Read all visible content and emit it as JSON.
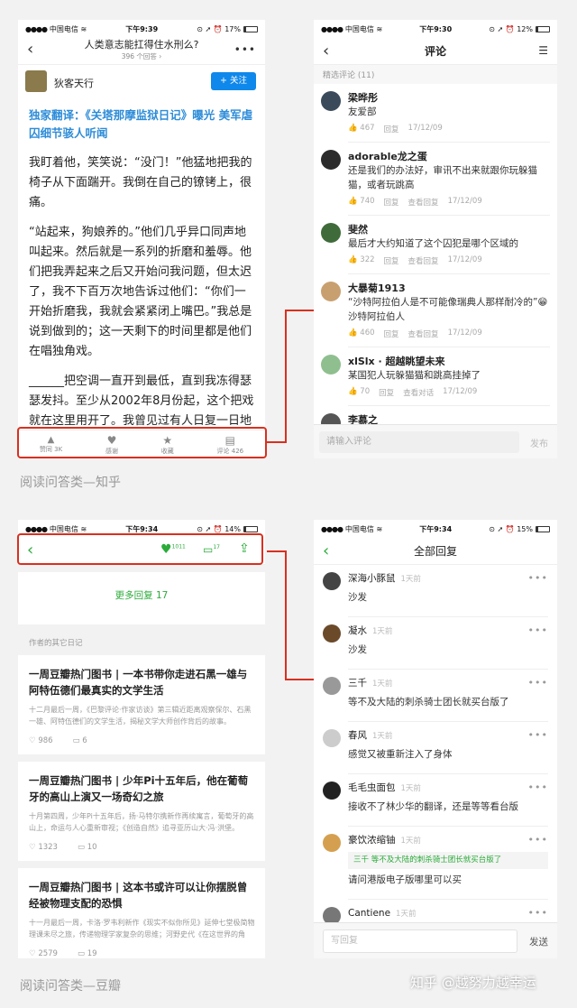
{
  "zhihu": {
    "status": {
      "carrier": "中国电信",
      "time": "下午9:39",
      "battery": "17%"
    },
    "nav_title": "人类意志能扛得住水刑么?",
    "nav_sub": "396 个回答",
    "author": "狄客天行",
    "follow": "+ 关注",
    "link": "独家翻译：《关塔那摩监狱日记》曝光 美军虐囚细节骇人听闻",
    "paragraphs": [
      "我盯着他，笑笑说：“没门！”他猛地把我的椅子从下面踹开。我倒在自己的镣铐上，很痛。",
      "“站起来，狗娘养的。”他们几乎异口同声地叫起来。然后就是一系列的折磨和羞辱。他们把我弄起来之后又开始问我问题，但太迟了，我不下百万次地告诉过他们：“你们一开始折磨我，我就会紧紧闭上嘴巴。”我总是说到做到的；这一天剩下的时间里都是他们在唱独角戏。",
      "______把空调一直开到最低，直到我冻得瑟瑟发抖。至少从2002年8月份起，这个把戏就在这里用开了。我曾见过有人日复一日地被关在冷冻室里；我可以给出一份长长的名"
    ],
    "bar": [
      "赞同 3K",
      "感谢",
      "收藏",
      "评论 426"
    ]
  },
  "zhihu_comments": {
    "status": {
      "carrier": "中国电信",
      "time": "下午9:30",
      "battery": "12%"
    },
    "title": "评论",
    "section": "精选评论 (11)",
    "items": [
      {
        "name": "梁晔彤",
        "text": "友爱部",
        "likes": "467",
        "reply": "回复",
        "view": "",
        "date": "17/12/09"
      },
      {
        "name": "adorable龙之蛋",
        "text": "还是我们的办法好，审讯不出来就跟你玩躲猫猫，或者玩跳高",
        "likes": "740",
        "reply": "回复",
        "view": "查看回复",
        "date": "17/12/09"
      },
      {
        "name": "斐然",
        "text": "最后才大约知道了这个囚犯是哪个区域的",
        "likes": "322",
        "reply": "回复",
        "view": "查看回复",
        "date": "17/12/09"
      },
      {
        "name": "大暴菊1913",
        "text": "“沙特阿拉伯人是不可能像瑞典人那样耐冷的”😁沙特阿拉伯人",
        "likes": "460",
        "reply": "回复",
        "view": "查看回复",
        "date": "17/12/09"
      },
      {
        "name": "xlSlx · 超越眺望未来",
        "text": "某国犯人玩躲猫猫和跳高挂掉了",
        "likes": "70",
        "reply": "回复",
        "view": "查看对话",
        "date": "17/12/09"
      },
      {
        "name": "李慕之",
        "text": "",
        "likes": "",
        "reply": "",
        "view": "",
        "date": ""
      }
    ],
    "input_placeholder": "请输入评论",
    "send": "发布"
  },
  "caption1": "阅读问答类—知乎",
  "douban": {
    "status": {
      "carrier": "中国电信",
      "time": "下午9:34",
      "battery": "14%"
    },
    "likes": "1011",
    "comments": "17",
    "more_replies": "更多回复 17",
    "section": "作者的其它日记",
    "items": [
      {
        "title": "一周豆瓣热门图书 | 一本书带你走进石黑一雄与阿特伍德们最真实的文学生活",
        "summary": "十二月最后一周，《巴黎评论·作家访谈》第三辑近距离观察保尔、石黑一雄、阿特伍德们的文学生活，揭秘文学大师创作背后的故事。",
        "likes": "986",
        "comments": "6"
      },
      {
        "title": "一周豆瓣热门图书 | 少年Pi十五年后，他在葡萄牙的高山上演又一场奇幻之旅",
        "summary": "十月第四周，少年Pi十五年后，扬·马特尔携新作再续寓言，葡萄牙的高山上，命运与人心重新审视；《创造自然》追寻亚历山大·冯·洪堡。",
        "likes": "1323",
        "comments": "10"
      },
      {
        "title": "一周豆瓣热门图书 | 这本书或许可以让你摆脱曾经被物理支配的恐惧",
        "summary": "十一月最后一周，卡洛·罗韦利新作《现实不似你所见》延伸七堂极简物理课未尽之旅，传递物理学家复杂的思维；河野史代《在这世界的角落》。",
        "likes": "2579",
        "comments": "19"
      }
    ]
  },
  "douban_replies": {
    "status": {
      "carrier": "中国电信",
      "time": "下午9:34",
      "battery": "15%"
    },
    "title": "全部回复",
    "items": [
      {
        "name": "深海小豚鼠",
        "time": "1天前",
        "text": "沙发",
        "quote": ""
      },
      {
        "name": "凝水",
        "time": "1天前",
        "text": "沙发",
        "quote": ""
      },
      {
        "name": "三千",
        "time": "1天前",
        "text": "等不及大陆的刺杀骑士团长就买台版了",
        "quote": ""
      },
      {
        "name": "春风",
        "time": "1天前",
        "text": "感觉又被重新注入了身体",
        "quote": ""
      },
      {
        "name": "毛毛虫面包",
        "time": "1天前",
        "text": "接收不了林少华的翻译，还是等等看台版",
        "quote": ""
      },
      {
        "name": "豪饮浓缩铀",
        "time": "1天前",
        "text": "请问港版电子版哪里可以买",
        "quote": "三千 等不及大陆的刺杀骑士团长就买台版了"
      },
      {
        "name": "Cantiene",
        "time": "1天前",
        "text": "",
        "quote": ""
      }
    ],
    "input_placeholder": "写回复",
    "send": "发送"
  },
  "caption2": "阅读问答类—豆瓣",
  "watermark": "知乎 @越努力越幸运",
  "colors": {
    "zhihu_blue": "#0f88eb",
    "douban_green": "#2bab3a",
    "highlight_red": "#d9301f"
  }
}
